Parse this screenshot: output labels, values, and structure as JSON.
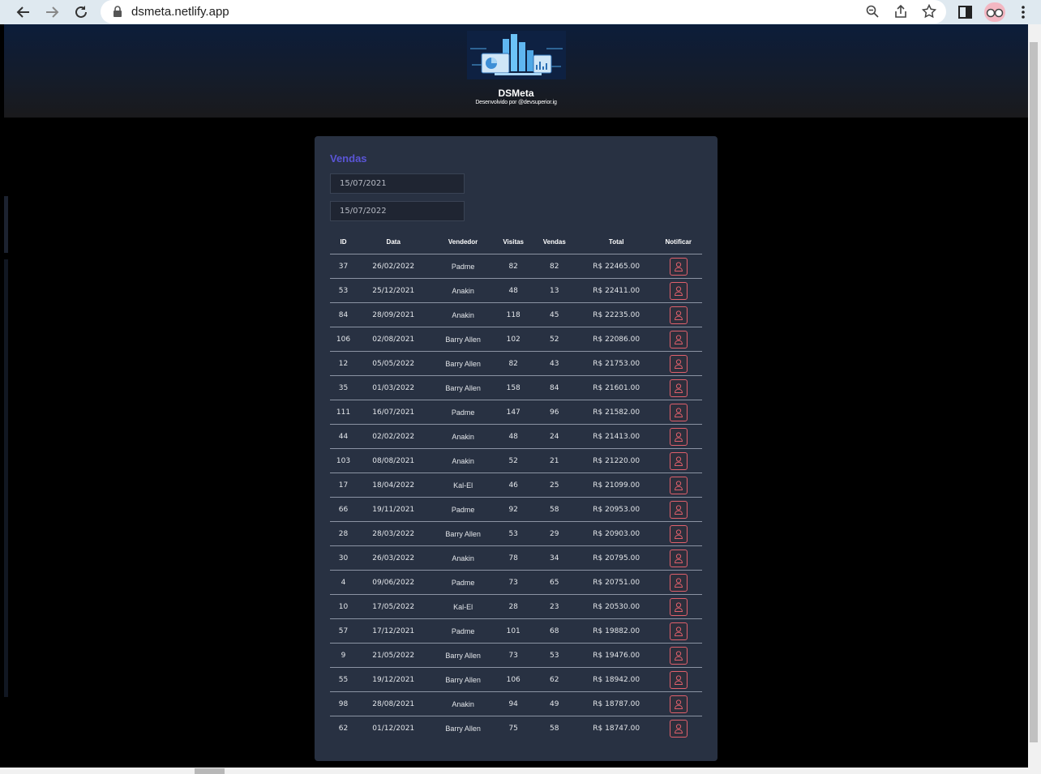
{
  "browser": {
    "url": "dsmeta.netlify.app"
  },
  "header": {
    "title": "DSMeta",
    "subtitle": "Desenvolvido por @devsuperior.ig"
  },
  "card": {
    "title": "Vendas",
    "min_date": "15/07/2021",
    "max_date": "15/07/2022"
  },
  "table": {
    "headers": [
      "ID",
      "Data",
      "Vendedor",
      "Visitas",
      "Vendas",
      "Total",
      "Notificar"
    ],
    "rows": [
      {
        "id": "37",
        "date": "26/02/2022",
        "seller": "Padme",
        "visits": "82",
        "deals": "82",
        "total": "R$ 22465.00"
      },
      {
        "id": "53",
        "date": "25/12/2021",
        "seller": "Anakin",
        "visits": "48",
        "deals": "13",
        "total": "R$ 22411.00"
      },
      {
        "id": "84",
        "date": "28/09/2021",
        "seller": "Anakin",
        "visits": "118",
        "deals": "45",
        "total": "R$ 22235.00"
      },
      {
        "id": "106",
        "date": "02/08/2021",
        "seller": "Barry Allen",
        "visits": "102",
        "deals": "52",
        "total": "R$ 22086.00"
      },
      {
        "id": "12",
        "date": "05/05/2022",
        "seller": "Barry Allen",
        "visits": "82",
        "deals": "43",
        "total": "R$ 21753.00"
      },
      {
        "id": "35",
        "date": "01/03/2022",
        "seller": "Barry Allen",
        "visits": "158",
        "deals": "84",
        "total": "R$ 21601.00"
      },
      {
        "id": "111",
        "date": "16/07/2021",
        "seller": "Padme",
        "visits": "147",
        "deals": "96",
        "total": "R$ 21582.00"
      },
      {
        "id": "44",
        "date": "02/02/2022",
        "seller": "Anakin",
        "visits": "48",
        "deals": "24",
        "total": "R$ 21413.00"
      },
      {
        "id": "103",
        "date": "08/08/2021",
        "seller": "Anakin",
        "visits": "52",
        "deals": "21",
        "total": "R$ 21220.00"
      },
      {
        "id": "17",
        "date": "18/04/2022",
        "seller": "Kal-El",
        "visits": "46",
        "deals": "25",
        "total": "R$ 21099.00"
      },
      {
        "id": "66",
        "date": "19/11/2021",
        "seller": "Padme",
        "visits": "92",
        "deals": "58",
        "total": "R$ 20953.00"
      },
      {
        "id": "28",
        "date": "28/03/2022",
        "seller": "Barry Allen",
        "visits": "53",
        "deals": "29",
        "total": "R$ 20903.00"
      },
      {
        "id": "30",
        "date": "26/03/2022",
        "seller": "Anakin",
        "visits": "78",
        "deals": "34",
        "total": "R$ 20795.00"
      },
      {
        "id": "4",
        "date": "09/06/2022",
        "seller": "Padme",
        "visits": "73",
        "deals": "65",
        "total": "R$ 20751.00"
      },
      {
        "id": "10",
        "date": "17/05/2022",
        "seller": "Kal-El",
        "visits": "28",
        "deals": "23",
        "total": "R$ 20530.00"
      },
      {
        "id": "57",
        "date": "17/12/2021",
        "seller": "Padme",
        "visits": "101",
        "deals": "68",
        "total": "R$ 19882.00"
      },
      {
        "id": "9",
        "date": "21/05/2022",
        "seller": "Barry Allen",
        "visits": "73",
        "deals": "53",
        "total": "R$ 19476.00"
      },
      {
        "id": "55",
        "date": "19/12/2021",
        "seller": "Barry Allen",
        "visits": "106",
        "deals": "62",
        "total": "R$ 18942.00"
      },
      {
        "id": "98",
        "date": "28/08/2021",
        "seller": "Anakin",
        "visits": "94",
        "deals": "49",
        "total": "R$ 18787.00"
      },
      {
        "id": "62",
        "date": "01/12/2021",
        "seller": "Barry Allen",
        "visits": "75",
        "deals": "58",
        "total": "R$ 18747.00"
      }
    ]
  },
  "colors": {
    "accent": "#5a55d6",
    "notify": "#e0606b",
    "card": "#283142"
  },
  "icons": {
    "back": "arrow-left-icon",
    "forward": "arrow-right-icon",
    "reload": "reload-icon",
    "lock": "lock-icon",
    "zoom": "zoom-icon",
    "share": "share-icon",
    "star": "star-icon",
    "sidepanel": "side-panel-icon",
    "menu": "kebab-menu-icon",
    "notify": "user-notify-icon"
  }
}
